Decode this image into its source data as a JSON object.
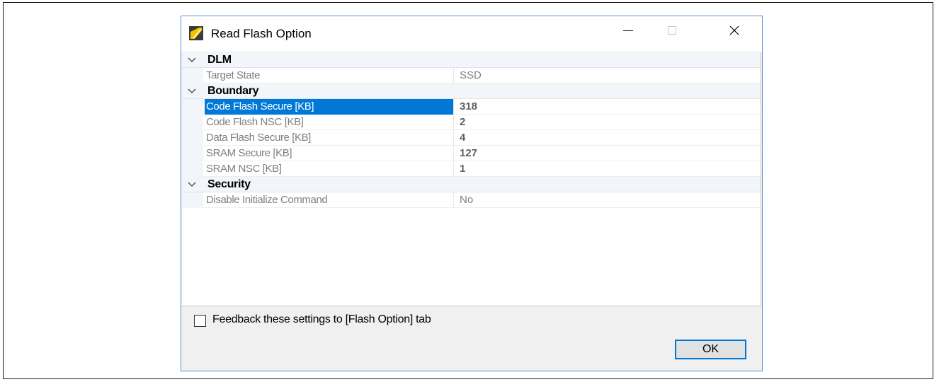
{
  "window": {
    "title": "Read Flash Option",
    "icon": "flash-tool-app-icon",
    "controls": [
      "minimize-icon",
      "maximize-icon",
      "close-icon"
    ]
  },
  "property_grid": {
    "categories": [
      {
        "label": "DLM",
        "expanded": true,
        "properties": [
          {
            "name": "Target State",
            "value": "SSD",
            "bold": false,
            "selected": false
          }
        ]
      },
      {
        "label": "Boundary",
        "expanded": true,
        "properties": [
          {
            "name": "Code Flash Secure [KB]",
            "value": "318",
            "bold": true,
            "selected": true
          },
          {
            "name": "Code Flash NSC [KB]",
            "value": "2",
            "bold": true,
            "selected": false
          },
          {
            "name": "Data Flash Secure [KB]",
            "value": "4",
            "bold": true,
            "selected": false
          },
          {
            "name": "SRAM Secure [KB]",
            "value": "127",
            "bold": true,
            "selected": false
          },
          {
            "name": "SRAM NSC [KB]",
            "value": "1",
            "bold": true,
            "selected": false
          }
        ]
      },
      {
        "label": "Security",
        "expanded": true,
        "properties": [
          {
            "name": "Disable Initialize Command",
            "value": "No",
            "bold": false,
            "selected": false
          }
        ]
      }
    ]
  },
  "footer": {
    "feedback_checkbox_label": "Feedback these settings to [Flash Option] tab",
    "feedback_checked": false,
    "ok_label": "OK"
  },
  "colors": {
    "selection": "#0078d7",
    "dialog_border": "#5a8fd0",
    "category_background": "#f2f5fa",
    "dimmed_text": "#7f7f7f"
  }
}
